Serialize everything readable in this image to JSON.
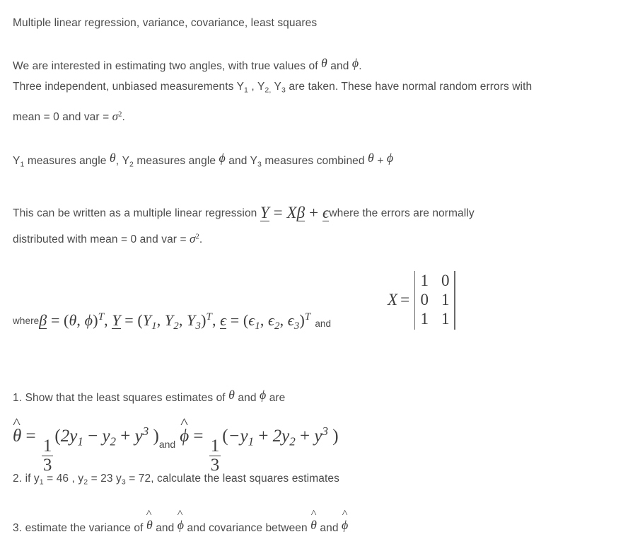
{
  "document": {
    "type": "statistics-question-sheet",
    "background_color": "#ffffff",
    "text_color": "#4a4a4a",
    "math_color": "#3c3c3c"
  },
  "title_line": "Multiple linear regression, variance, covariance, least squares",
  "intro": {
    "line1_a": "We are interested in estimating two angles, with true values of ",
    "line1_theta": "θ",
    "line1_b": " and ",
    "line1_phi": "ϕ",
    "line1_c": ".",
    "line2_a": "Three independent, unbiased measurements Y",
    "line2_sub1": "1",
    "line2_b": " , Y",
    "line2_sub2": "2,",
    "line2_c": " Y",
    "line2_sub3": "3",
    "line2_d": " are taken. These have normal random errors with",
    "line3_a": "mean = 0 and var = ",
    "line3_sigma": "σ",
    "line3_sup": "2",
    "line3_b": "."
  },
  "measures": {
    "a": "Y",
    "sub1": "1",
    "b": " measures angle ",
    "theta": "θ",
    "c": ", Y",
    "sub2": "2",
    "d": " measures angle ",
    "phi": "ϕ",
    "e": " and Y",
    "sub3": "3",
    "f": " measures combined ",
    "theta2": "θ",
    "g": " + ",
    "phi2": "ϕ"
  },
  "regression": {
    "lead": "This can be written as a multiple linear regression ",
    "equation": {
      "Y": "Y",
      "eq": " = ",
      "X": "X",
      "beta": "β",
      "plus": " + ",
      "epsilon": "ϵ"
    },
    "trail": "where the errors are normally",
    "line2_a": "distributed with mean = 0 and var = ",
    "line2_sigma": "σ",
    "line2_sup": "2",
    "line2_b": "."
  },
  "where_clause": {
    "where_label": "where",
    "beta": "β",
    "eq": " = (",
    "theta": "θ",
    "comma": ", ",
    "phi": "ϕ",
    "close_T": ")",
    "T": "T",
    "sep": ", ",
    "Y": "Y",
    "Y_eq": " = (",
    "Y1": "Y",
    "Y1sub": "1",
    "Y2": "Y",
    "Y2sub": "2",
    "Y3": "Y",
    "Y3sub": "3",
    "eps": "ϵ",
    "eps_eq": " = (",
    "e1": "ϵ",
    "e1sub": "1",
    "e2": "ϵ",
    "e2sub": "2",
    "e3": "ϵ",
    "e3sub": "3",
    "and_label": "and"
  },
  "matrix": {
    "lhs": "X",
    "equals": "=",
    "rows": [
      [
        "1",
        "0"
      ],
      [
        "0",
        "1"
      ],
      [
        "1",
        "1"
      ]
    ],
    "delimiter": "vertical-bar"
  },
  "questions": [
    {
      "number": "1.",
      "text_a": "Show that the least squares estimates of ",
      "theta": "θ",
      "text_b": " and ",
      "phi": "ϕ",
      "text_c": " are"
    },
    {
      "number": "2.",
      "text": "if y",
      "y1_sub": "1",
      "y1_val": " = 46 , y",
      "y2_sub": "2",
      "y2_val": " = 23 y",
      "y3_sub": "3",
      "y3_val": " = 72, calculate the least squares estimates"
    },
    {
      "number": "3.",
      "text_a": "estimate the variance of ",
      "theta": "θ",
      "text_b": " and ",
      "phi": "ϕ",
      "text_c": " and covariance between ",
      "theta2": "θ",
      "text_d": " and ",
      "phi2": "ϕ"
    }
  ],
  "estimates": {
    "theta_hat": {
      "symbol": "θ",
      "equals": "=",
      "frac_num": "1",
      "frac_den": "3",
      "open": "(",
      "term1": "2y",
      "term1_sub": "1",
      "op1": " − ",
      "term2": "y",
      "term2_sub": "2",
      "op2": " + ",
      "term3": "y",
      "term3_sup": "3",
      "close": " )"
    },
    "connector": "and",
    "phi_hat": {
      "symbol": "ϕ",
      "equals": "=",
      "frac_num": "1",
      "frac_den": "3",
      "open": "(",
      "term1": "−y",
      "term1_sub": "1",
      "op1": " + ",
      "term2": "2y",
      "term2_sub": "2",
      "op2": " + ",
      "term3": "y",
      "term3_sup": "3",
      "close": " )"
    }
  }
}
